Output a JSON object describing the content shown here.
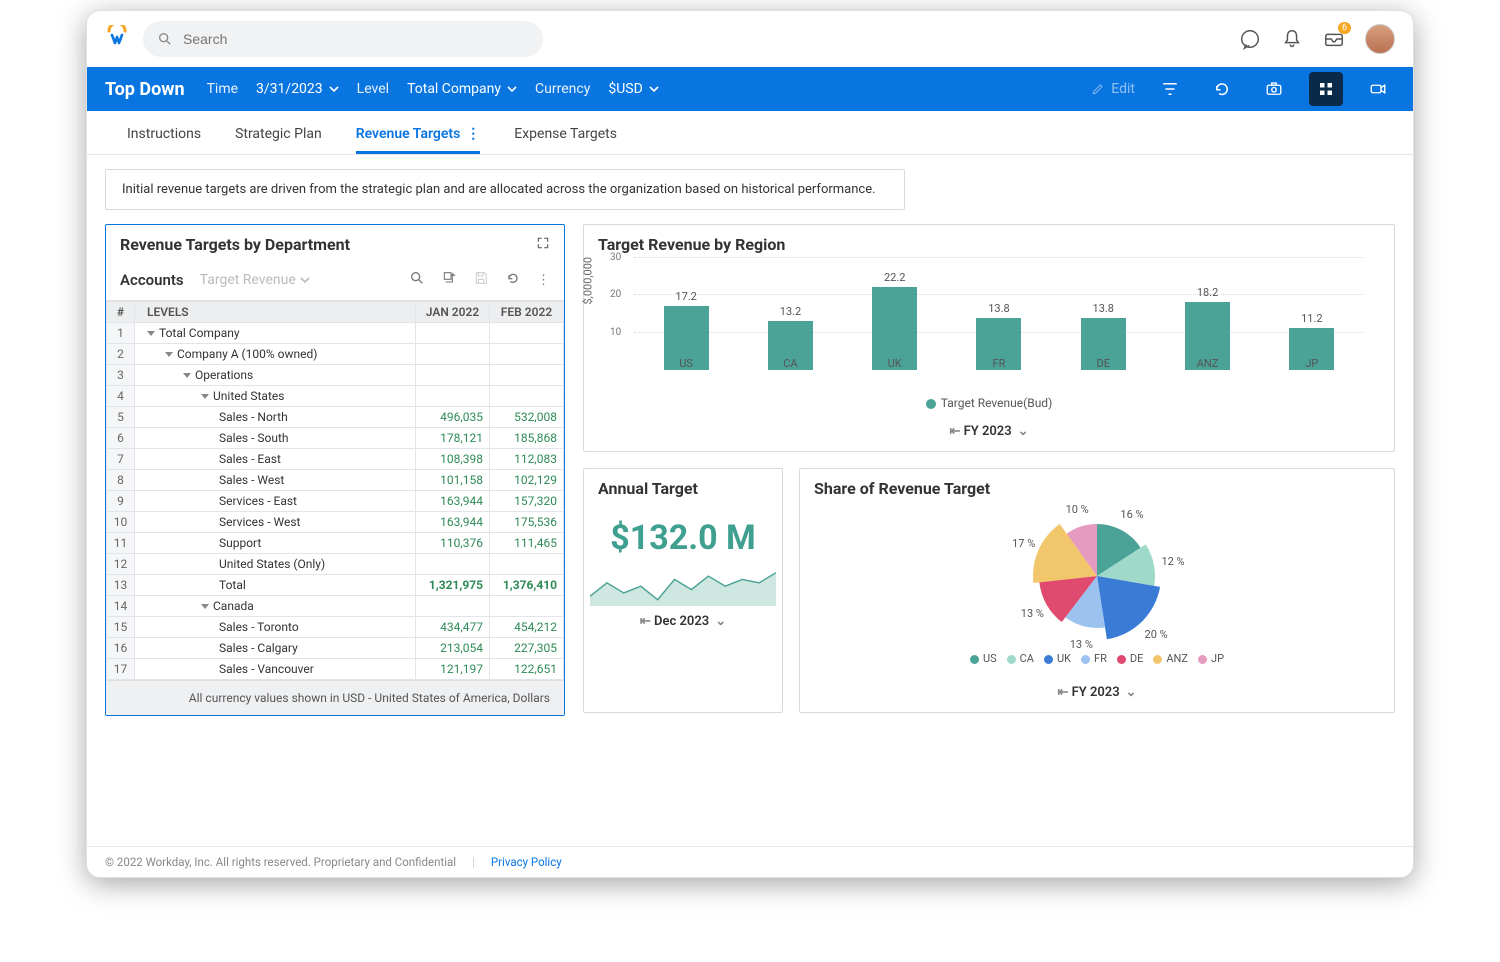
{
  "topbar": {
    "search_placeholder": "Search",
    "inbox_badge": "6"
  },
  "bluebar": {
    "title": "Top Down",
    "time_label": "Time",
    "time_value": "3/31/2023",
    "level_label": "Level",
    "level_value": "Total Company",
    "currency_label": "Currency",
    "currency_value": "$USD",
    "edit_label": "Edit"
  },
  "tabs": {
    "t0": "Instructions",
    "t1": "Strategic Plan",
    "t2": "Revenue Targets",
    "t3": "Expense Targets"
  },
  "banner": "Initial revenue targets are driven from the strategic plan and are allocated across the organization based on historical performance.",
  "grid_panel": {
    "title": "Revenue Targets by Department",
    "accounts_label": "Accounts",
    "selector": "Target Revenue",
    "col_num": "#",
    "col_levels": "LEVELS",
    "col_a": "JAN 2022",
    "col_b": "FEB 2022",
    "rows": [
      {
        "n": "1",
        "indent": 0,
        "caret": true,
        "label": "Total Company",
        "a": "",
        "b": ""
      },
      {
        "n": "2",
        "indent": 1,
        "caret": true,
        "label": "Company A (100% owned)",
        "a": "",
        "b": ""
      },
      {
        "n": "3",
        "indent": 2,
        "caret": true,
        "label": "Operations",
        "a": "",
        "b": ""
      },
      {
        "n": "4",
        "indent": 3,
        "caret": true,
        "label": "United States",
        "a": "",
        "b": ""
      },
      {
        "n": "5",
        "indent": 4,
        "caret": false,
        "label": "Sales - North",
        "a": "496,035",
        "b": "532,008"
      },
      {
        "n": "6",
        "indent": 4,
        "caret": false,
        "label": "Sales - South",
        "a": "178,121",
        "b": "185,868"
      },
      {
        "n": "7",
        "indent": 4,
        "caret": false,
        "label": "Sales - East",
        "a": "108,398",
        "b": "112,083"
      },
      {
        "n": "8",
        "indent": 4,
        "caret": false,
        "label": "Sales - West",
        "a": "101,158",
        "b": "102,129"
      },
      {
        "n": "9",
        "indent": 4,
        "caret": false,
        "label": "Services - East",
        "a": "163,944",
        "b": "157,320"
      },
      {
        "n": "10",
        "indent": 4,
        "caret": false,
        "label": "Services - West",
        "a": "163,944",
        "b": "175,536"
      },
      {
        "n": "11",
        "indent": 4,
        "caret": false,
        "label": "Support",
        "a": "110,376",
        "b": "111,465"
      },
      {
        "n": "12",
        "indent": 4,
        "caret": false,
        "label": "United States (Only)",
        "a": "",
        "b": ""
      },
      {
        "n": "13",
        "indent": 4,
        "caret": false,
        "label": "Total",
        "a": "1,321,975",
        "b": "1,376,410",
        "bold": true
      },
      {
        "n": "14",
        "indent": 3,
        "caret": true,
        "label": "Canada",
        "a": "",
        "b": ""
      },
      {
        "n": "15",
        "indent": 4,
        "caret": false,
        "label": "Sales - Toronto",
        "a": "434,477",
        "b": "454,212"
      },
      {
        "n": "16",
        "indent": 4,
        "caret": false,
        "label": "Sales - Calgary",
        "a": "213,054",
        "b": "227,305"
      },
      {
        "n": "17",
        "indent": 4,
        "caret": false,
        "label": "Sales - Vancouver",
        "a": "121,197",
        "b": "122,651"
      }
    ],
    "footnote": "All currency values shown in USD - United States of America, Dollars"
  },
  "region_chart": {
    "title": "Target Revenue by Region",
    "ylabel": "$,000,000",
    "legend": "Target Revenue(Bud)",
    "period": "FY 2023"
  },
  "annual": {
    "title": "Annual Target",
    "value": "$132.0 M",
    "period": "Dec 2023"
  },
  "share": {
    "title": "Share of Revenue Target",
    "period": "FY 2023"
  },
  "footer": {
    "copyright": "© 2022 Workday, Inc. All rights reserved. Proprietary and Confidential",
    "privacy": "Privacy Policy"
  },
  "chart_data": [
    {
      "type": "bar",
      "title": "Target Revenue by Region",
      "ylabel": "$,000,000",
      "ylim": [
        0,
        30
      ],
      "yticks": [
        10,
        20,
        30
      ],
      "categories": [
        "US",
        "CA",
        "UK",
        "FR",
        "DE",
        "ANZ",
        "JP"
      ],
      "series": [
        {
          "name": "Target Revenue(Bud)",
          "values": [
            17.2,
            13.2,
            22.2,
            13.8,
            13.8,
            18.2,
            11.2
          ]
        }
      ],
      "period": "FY 2023"
    },
    {
      "type": "pie",
      "title": "Share of Revenue Target",
      "categories": [
        "US",
        "CA",
        "UK",
        "FR",
        "DE",
        "ANZ",
        "JP"
      ],
      "values": [
        16,
        12,
        20,
        13,
        13,
        17,
        10
      ],
      "colors": [
        "#4aa396",
        "#9fd9c9",
        "#3a7bd5",
        "#9cc3ef",
        "#e04a6e",
        "#f2c66b",
        "#e59abf"
      ],
      "period": "FY 2023",
      "label_suffix": " %"
    },
    {
      "type": "line",
      "title": "Annual Target sparkline",
      "values": [
        118,
        126,
        120,
        124,
        116,
        128,
        122,
        130,
        124,
        128,
        126,
        132
      ]
    }
  ]
}
